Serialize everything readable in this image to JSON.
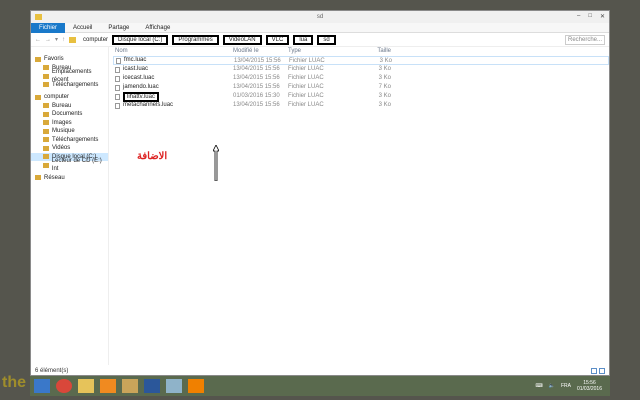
{
  "window": {
    "title": "sd",
    "controls": [
      "–",
      "□",
      "✕"
    ]
  },
  "ribbon": {
    "tabs": [
      "Fichier",
      "Accueil",
      "Partage",
      "Affichage"
    ]
  },
  "address": {
    "nav": [
      "←",
      "→",
      "▾",
      "↑"
    ],
    "crumbs": [
      "computer",
      "Disque local (C:)",
      "Programmes",
      "VideoLAN",
      "VLC",
      "lua",
      "sd"
    ],
    "search_placeholder": "Recherche..."
  },
  "sidebar": {
    "groups": [
      {
        "label": "Favoris",
        "items": [
          "Bureau",
          "Emplacements récent",
          "Téléchargements"
        ]
      },
      {
        "label": "computer",
        "items": [
          "Bureau",
          "Documents",
          "Images",
          "Musique",
          "Téléchargements",
          "Vidéos",
          "Disque local (C:)",
          "Lecteur de CD (E:) Int"
        ]
      },
      {
        "label": "Réseau",
        "items": []
      }
    ]
  },
  "columns": [
    "Nom",
    "Modifié le",
    "Type",
    "Taille"
  ],
  "files": [
    {
      "name": "fmc.luac",
      "date": "13/04/2015 15:56",
      "type": "Fichier LUAC",
      "size": "3 Ko"
    },
    {
      "name": "icast.luac",
      "date": "13/04/2015 15:56",
      "type": "Fichier LUAC",
      "size": "3 Ko"
    },
    {
      "name": "icecast.luac",
      "date": "13/04/2015 15:56",
      "type": "Fichier LUAC",
      "size": "3 Ko"
    },
    {
      "name": "jamendo.luac",
      "date": "13/04/2015 15:56",
      "type": "Fichier LUAC",
      "size": "7 Ko"
    },
    {
      "name": "lihattv.luac",
      "date": "01/03/2016 15:30",
      "type": "Fichier LUAC",
      "size": "3 Ko"
    },
    {
      "name": "metachannels.luac",
      "date": "13/04/2015 15:56",
      "type": "Fichier LUAC",
      "size": "3 Ko"
    }
  ],
  "annotation": "الاضافة",
  "status": "6 élément(s)",
  "taskbar": {
    "apps": [
      "windows",
      "chrome",
      "explorer",
      "uc-browser",
      "tool",
      "word",
      "paint",
      "vlc"
    ],
    "lang": "FRA",
    "time": "15:56",
    "date": "01/03/2016"
  },
  "watermark": "the"
}
